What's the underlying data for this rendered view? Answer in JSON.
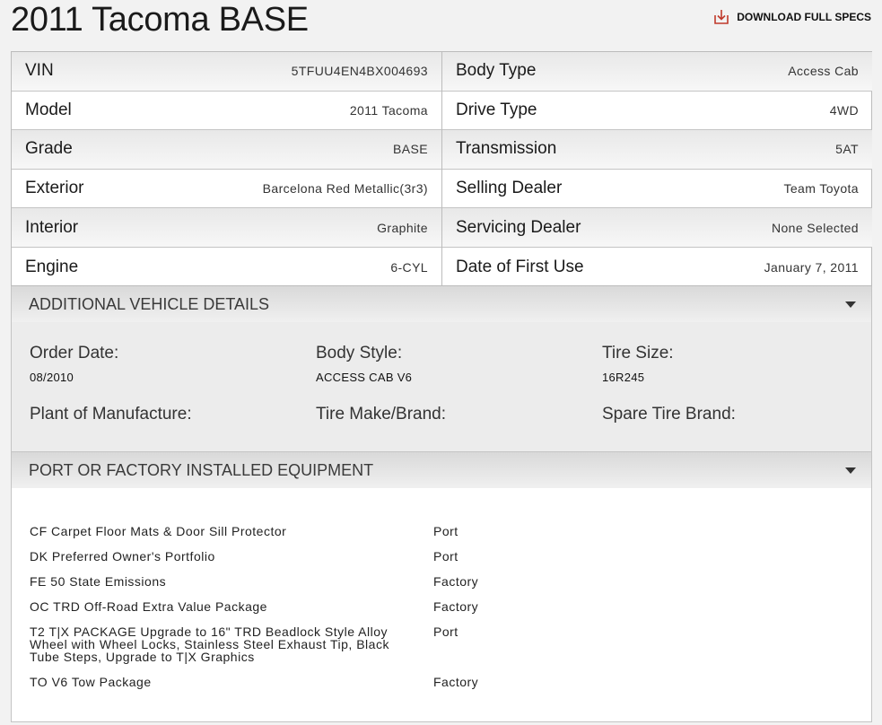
{
  "header": {
    "title": "2011 Tacoma BASE",
    "download_label": "DOWNLOAD FULL SPECS"
  },
  "specs": {
    "left": [
      {
        "label": "VIN",
        "value": "5TFUU4EN4BX004693"
      },
      {
        "label": "Model",
        "value": "2011 Tacoma"
      },
      {
        "label": "Grade",
        "value": "BASE"
      },
      {
        "label": "Exterior",
        "value": "Barcelona Red Metallic(3r3)"
      },
      {
        "label": "Interior",
        "value": "Graphite"
      },
      {
        "label": "Engine",
        "value": "6-CYL"
      }
    ],
    "right": [
      {
        "label": "Body Type",
        "value": "Access Cab"
      },
      {
        "label": "Drive Type",
        "value": "4WD"
      },
      {
        "label": "Transmission",
        "value": "5AT"
      },
      {
        "label": "Selling Dealer",
        "value": "Team Toyota"
      },
      {
        "label": "Servicing Dealer",
        "value": "None Selected"
      },
      {
        "label": "Date of First Use",
        "value": "January 7, 2011"
      }
    ]
  },
  "additional": {
    "heading": "ADDITIONAL VEHICLE DETAILS",
    "order_date": {
      "label": "Order Date:",
      "value": "08/2010"
    },
    "body_style": {
      "label": "Body Style:",
      "value": "ACCESS CAB V6"
    },
    "tire_size": {
      "label": "Tire Size:",
      "value": "16R245"
    },
    "plant": {
      "label": "Plant of Manufacture:",
      "value": ""
    },
    "tire_make": {
      "label": "Tire Make/Brand:",
      "value": ""
    },
    "spare_tire": {
      "label": "Spare Tire Brand:",
      "value": ""
    }
  },
  "equipment": {
    "heading": "PORT OR FACTORY INSTALLED EQUIPMENT",
    "items": [
      {
        "name": "CF Carpet Floor Mats & Door Sill Protector",
        "source": "Port"
      },
      {
        "name": "DK Preferred Owner's Portfolio",
        "source": "Port"
      },
      {
        "name": "FE 50 State Emissions",
        "source": "Factory"
      },
      {
        "name": "OC TRD Off-Road Extra Value Package",
        "source": "Factory"
      },
      {
        "name": "T2 T|X PACKAGE Upgrade to 16\" TRD Beadlock Style Alloy Wheel with Wheel Locks, Stainless Steel Exhaust Tip, Black Tube Steps, Upgrade to T|X Graphics",
        "source": "Port"
      },
      {
        "name": "TO V6 Tow Package",
        "source": "Factory"
      }
    ]
  },
  "icons": {
    "download": "download-icon",
    "collapse": "caret-down-icon"
  },
  "colors": {
    "download_icon": "#c0392b",
    "section_text": "#3a3a3a"
  }
}
